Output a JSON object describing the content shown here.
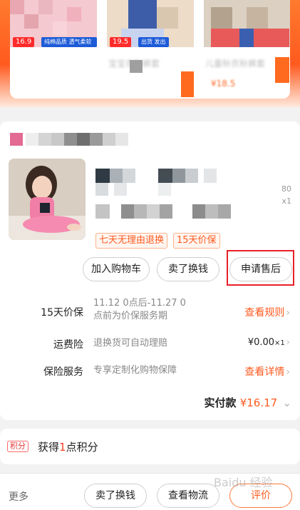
{
  "recommendations": [
    {
      "name": "",
      "price_badge": "16.9",
      "tag": "纯棉品质 透气柔软舒适",
      "price": ""
    },
    {
      "name": "宝宝衣秋裤套",
      "price_badge": "19.5",
      "tag": "出货 发出",
      "price": ""
    },
    {
      "name": "儿童秋衣秋裤套",
      "price_badge": "",
      "tag": "",
      "price": "¥18.5"
    }
  ],
  "order": {
    "quantity": "x1",
    "price_prefix": "80",
    "badges": [
      "七天无理由退换",
      "15天价保"
    ],
    "buttons": {
      "add_to_cart": "加入购物车",
      "sell_for_cash": "卖了换钱",
      "apply_after_sale": "申请售后"
    },
    "price_protect": {
      "label": "15天价保",
      "desc_line1": "11.12 0点后-11.27 0",
      "desc_line2": "点前为价保服务期",
      "link": "查看规则"
    },
    "shipping_insurance": {
      "label": "运费险",
      "desc": "退换货可自动理赔",
      "value": "¥0.00",
      "multiplier": "×1"
    },
    "insurance_service": {
      "label": "保险服务",
      "desc": "专享定制化购物保障",
      "link": "查看详情"
    },
    "actual_payment": {
      "label": "实付款",
      "amount": "¥16.17"
    }
  },
  "points": {
    "tag": "积分",
    "text_prefix": "获得",
    "number": "1",
    "text_suffix": "点积分"
  },
  "bottom_bar": {
    "more": "更多",
    "sell_for_cash": "卖了换钱",
    "view_logistics": "查看物流",
    "review": "评价"
  },
  "watermark": "Baidu 经验",
  "colors": {
    "accent": "#ff5a1f",
    "highlight_box": "#e8202a",
    "banner_top": "#ff7a2e"
  }
}
